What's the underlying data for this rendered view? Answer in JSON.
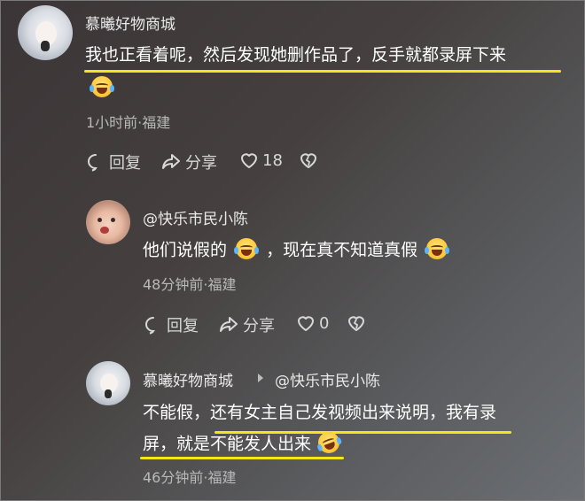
{
  "comments": [
    {
      "username": "慕曦好物商城",
      "text_line1": "我也正看着呢，然后发现她删作品了，反手就都录屏下来",
      "meta": "1小时前·福建",
      "reply_label": "回复",
      "share_label": "分享",
      "like_count": "18"
    },
    {
      "username": "@快乐市民小陈",
      "text_part1": "他们说假的",
      "text_part2": "，现在真不知道真假",
      "meta": "48分钟前·福建",
      "reply_label": "回复",
      "share_label": "分享",
      "like_count": "0"
    },
    {
      "username": "慕曦好物商城",
      "reply_to": "@快乐市民小陈",
      "text_line1": "不能假，还有女主自己发视频出来说明，我有录",
      "text_line2": "屏，就是不能发人出来",
      "meta": "46分钟前·福建"
    }
  ],
  "icons": {
    "reply": "comment-bubble-icon",
    "share": "share-arrow-icon",
    "like": "heart-icon",
    "dislike": "broken-heart-icon",
    "emoji": "laughing-tears-emoji"
  },
  "colors": {
    "highlight_underline": "#f5e61a",
    "meta_text": "#b9b9b9"
  }
}
